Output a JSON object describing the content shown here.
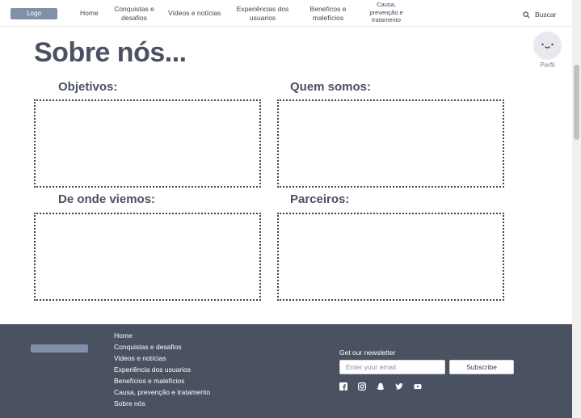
{
  "header": {
    "logo": "Logo",
    "nav": [
      "Home",
      "Conquistas e desafios",
      "Vídeos e notícias",
      "Experiências dos usuarios",
      "Benefícos e malefícios",
      "Causa, prevenção e tratamento"
    ],
    "search_label": "Buscar"
  },
  "profile": {
    "label": "Perfil"
  },
  "main": {
    "title": "Sobre nós...",
    "sections": [
      "Objetivos:",
      "Quem somos:",
      "De onde viemos:",
      "Parceiros:"
    ]
  },
  "footer": {
    "links": [
      "Home",
      "Conquistas e desafios",
      "Videos e notícias",
      "Experiência dos usuarios",
      "Benefícios e malefícios",
      "Causa, prevenção e tratamento",
      "Sobre nós"
    ],
    "newsletter_title": "Get our newsletter",
    "email_placeholder": "Enter your email",
    "subscribe_label": "Subscribe",
    "socials": [
      "facebook-icon",
      "instagram-icon",
      "snapchat-icon",
      "twitter-icon",
      "youtube-icon"
    ]
  },
  "colors": {
    "logo_bg": "#8190a8",
    "footer_bg": "#4a5261",
    "text": "#4a5160"
  }
}
